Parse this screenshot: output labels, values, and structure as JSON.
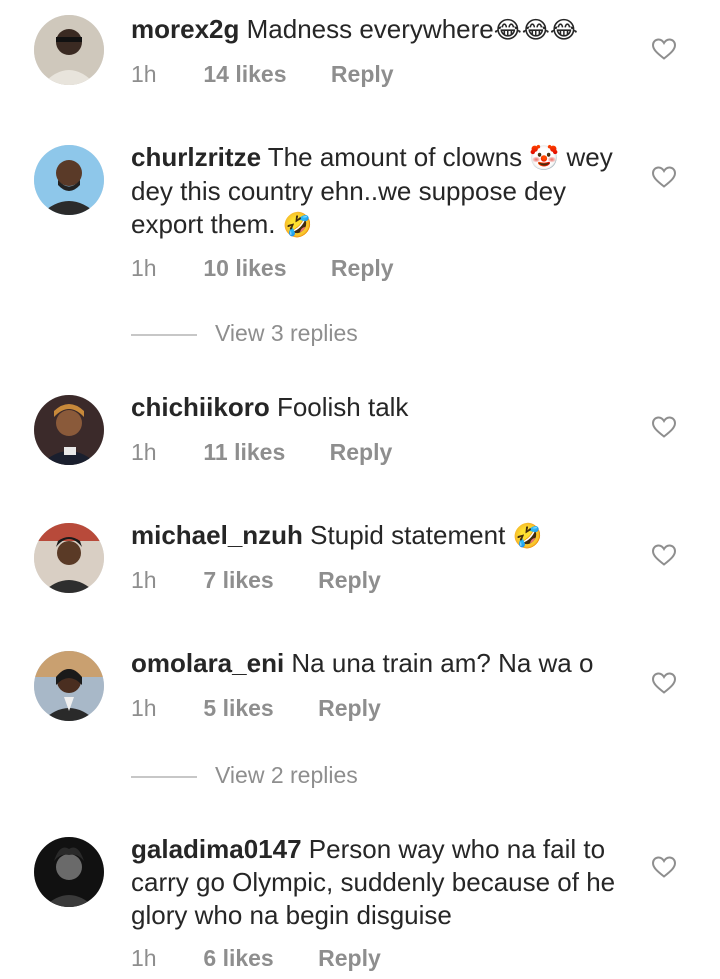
{
  "colors": {
    "text": "#262626",
    "muted": "#8e8e8e",
    "divider": "#c7c7c7"
  },
  "comments": [
    {
      "username": "morex2g",
      "text": "Madness everywhere",
      "emoji": "😂😂😂",
      "time": "1h",
      "likes": "14 likes",
      "reply": "Reply"
    },
    {
      "username": "churlzritze",
      "text": "The amount of clowns",
      "emoji": "🤡",
      "text2": "wey dey this country ehn..we suppose dey export them.",
      "emoji2": "🤣",
      "time": "1h",
      "likes": "10 likes",
      "reply": "Reply",
      "view_replies": "View 3 replies"
    },
    {
      "username": "chichiikoro",
      "text": "Foolish talk",
      "time": "1h",
      "likes": "11 likes",
      "reply": "Reply"
    },
    {
      "username": "michael_nzuh",
      "text": "Stupid statement",
      "emoji": "🤣",
      "time": "1h",
      "likes": "7 likes",
      "reply": "Reply"
    },
    {
      "username": "omolara_eni",
      "text": "Na una train am? Na wa o",
      "time": "1h",
      "likes": "5 likes",
      "reply": "Reply",
      "view_replies": "View 2 replies"
    },
    {
      "username": "galadima0147",
      "text": "Person way who na fail to carry go Olympic, suddenly because of he glory who na begin disguise",
      "time": "1h",
      "likes": "6 likes",
      "reply": "Reply"
    }
  ]
}
